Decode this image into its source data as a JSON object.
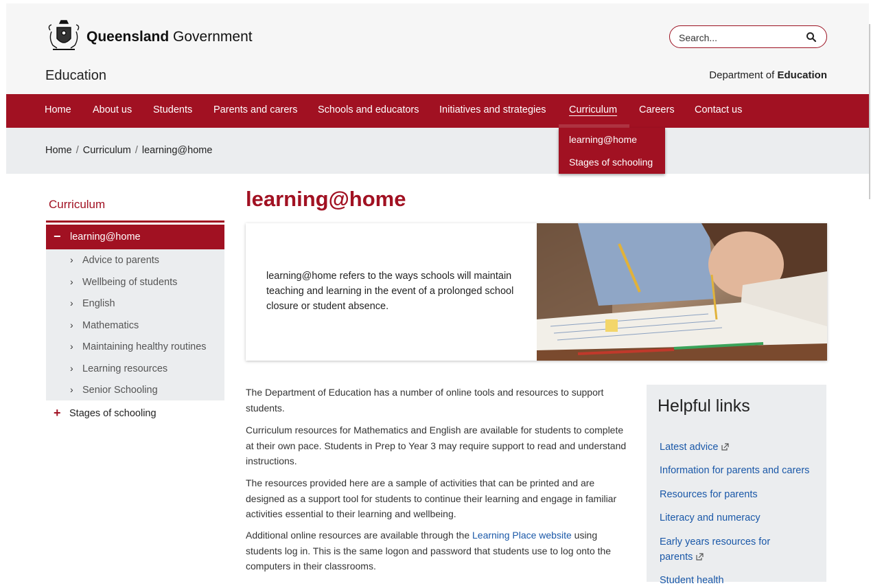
{
  "header": {
    "brand_strong": "Queensland",
    "brand_rest": " Government",
    "site_title": "Education",
    "dept_prefix": "Department of ",
    "dept_strong": "Education",
    "search_placeholder": "Search..."
  },
  "nav": {
    "items": [
      {
        "label": "Home"
      },
      {
        "label": "About us"
      },
      {
        "label": "Students"
      },
      {
        "label": "Parents and carers"
      },
      {
        "label": "Schools and educators"
      },
      {
        "label": "Initiatives and strategies"
      },
      {
        "label": "Curriculum"
      },
      {
        "label": "Careers"
      },
      {
        "label": "Contact us"
      }
    ],
    "active": "Curriculum",
    "dropdown": [
      {
        "label": "learning@home"
      },
      {
        "label": "Stages of schooling"
      }
    ]
  },
  "breadcrumb": {
    "items": [
      "Home",
      "Curriculum",
      "learning@home"
    ],
    "separator": "/"
  },
  "sidebar": {
    "title": "Curriculum",
    "active_label": "learning@home",
    "subitems": [
      {
        "label": "Advice to parents"
      },
      {
        "label": "Wellbeing of students"
      },
      {
        "label": "English"
      },
      {
        "label": "Mathematics"
      },
      {
        "label": "Maintaining healthy routines"
      },
      {
        "label": "Learning resources"
      },
      {
        "label": "Senior Schooling"
      }
    ],
    "collapsed_label": "Stages of schooling"
  },
  "main": {
    "title": "learning@home",
    "hero_text": "learning@home refers to the ways schools will maintain teaching and learning in the event of a prolonged school closure or student absence.",
    "paragraphs": [
      "The Department of Education has a number of online tools and resources to support students.",
      "Curriculum resources for Mathematics and English are available for students to complete at their own pace. Students in Prep to Year 3 may require support to read and understand instructions.",
      "The resources provided here are a sample of activities that can be printed and are designed as a support tool for students to continue their learning and engage in familiar activities essential to their learning and wellbeing."
    ],
    "para4_before": "Additional online resources are available through the ",
    "para4_link": "Learning Place website",
    "para4_after": " using students log in. This is the same logon and password that students use to log onto the computers in their classrooms."
  },
  "helpful_links": {
    "title": "Helpful links",
    "links": [
      {
        "label": "Latest advice",
        "external": true
      },
      {
        "label": "Information for parents and carers",
        "external": false
      },
      {
        "label": "Resources for parents",
        "external": false
      },
      {
        "label": "Literacy and numeracy",
        "external": false
      },
      {
        "label": "Early years resources for parents",
        "external": true
      },
      {
        "label": "Student health",
        "external": false
      }
    ]
  },
  "colors": {
    "brand_red": "#a11122",
    "link_blue": "#1a58a8",
    "panel_grey": "#ebedef"
  },
  "icons": [
    "qld-crest-icon",
    "search-icon",
    "minus-icon",
    "plus-icon",
    "chevron-right-icon",
    "external-link-icon"
  ]
}
